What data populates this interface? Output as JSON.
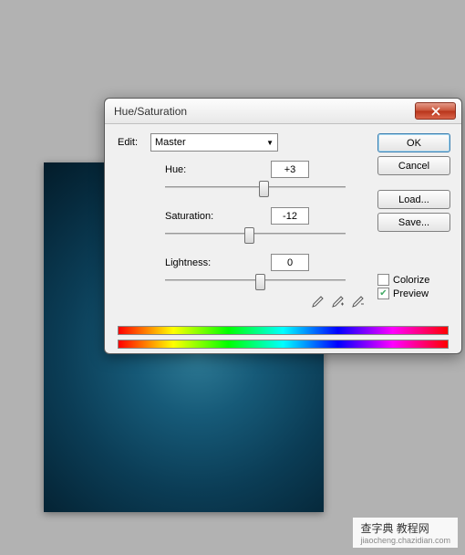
{
  "dialog": {
    "title": "Hue/Saturation",
    "edit_label": "Edit:",
    "edit_value": "Master",
    "hue": {
      "label": "Hue:",
      "value": "+3",
      "pos": 52
    },
    "saturation": {
      "label": "Saturation:",
      "value": "-12",
      "pos": 44
    },
    "lightness": {
      "label": "Lightness:",
      "value": "0",
      "pos": 50
    },
    "buttons": {
      "ok": "OK",
      "cancel": "Cancel",
      "load": "Load...",
      "save": "Save..."
    },
    "colorize": {
      "label": "Colorize",
      "checked": false
    },
    "preview": {
      "label": "Preview",
      "checked": true
    }
  },
  "watermark": {
    "text": "查字典 教程网",
    "url": "jiaocheng.chazidian.com"
  }
}
